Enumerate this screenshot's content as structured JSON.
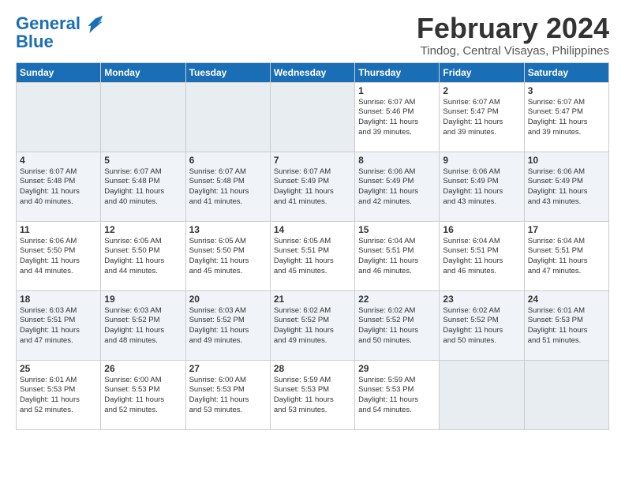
{
  "header": {
    "logo_text1": "General",
    "logo_text2": "Blue",
    "month": "February 2024",
    "location": "Tindog, Central Visayas, Philippines"
  },
  "days_of_week": [
    "Sunday",
    "Monday",
    "Tuesday",
    "Wednesday",
    "Thursday",
    "Friday",
    "Saturday"
  ],
  "weeks": [
    [
      {
        "day": "",
        "info": ""
      },
      {
        "day": "",
        "info": ""
      },
      {
        "day": "",
        "info": ""
      },
      {
        "day": "",
        "info": ""
      },
      {
        "day": "1",
        "info": "Sunrise: 6:07 AM\nSunset: 5:46 PM\nDaylight: 11 hours\nand 39 minutes."
      },
      {
        "day": "2",
        "info": "Sunrise: 6:07 AM\nSunset: 5:47 PM\nDaylight: 11 hours\nand 39 minutes."
      },
      {
        "day": "3",
        "info": "Sunrise: 6:07 AM\nSunset: 5:47 PM\nDaylight: 11 hours\nand 39 minutes."
      }
    ],
    [
      {
        "day": "4",
        "info": "Sunrise: 6:07 AM\nSunset: 5:48 PM\nDaylight: 11 hours\nand 40 minutes."
      },
      {
        "day": "5",
        "info": "Sunrise: 6:07 AM\nSunset: 5:48 PM\nDaylight: 11 hours\nand 40 minutes."
      },
      {
        "day": "6",
        "info": "Sunrise: 6:07 AM\nSunset: 5:48 PM\nDaylight: 11 hours\nand 41 minutes."
      },
      {
        "day": "7",
        "info": "Sunrise: 6:07 AM\nSunset: 5:49 PM\nDaylight: 11 hours\nand 41 minutes."
      },
      {
        "day": "8",
        "info": "Sunrise: 6:06 AM\nSunset: 5:49 PM\nDaylight: 11 hours\nand 42 minutes."
      },
      {
        "day": "9",
        "info": "Sunrise: 6:06 AM\nSunset: 5:49 PM\nDaylight: 11 hours\nand 43 minutes."
      },
      {
        "day": "10",
        "info": "Sunrise: 6:06 AM\nSunset: 5:49 PM\nDaylight: 11 hours\nand 43 minutes."
      }
    ],
    [
      {
        "day": "11",
        "info": "Sunrise: 6:06 AM\nSunset: 5:50 PM\nDaylight: 11 hours\nand 44 minutes."
      },
      {
        "day": "12",
        "info": "Sunrise: 6:05 AM\nSunset: 5:50 PM\nDaylight: 11 hours\nand 44 minutes."
      },
      {
        "day": "13",
        "info": "Sunrise: 6:05 AM\nSunset: 5:50 PM\nDaylight: 11 hours\nand 45 minutes."
      },
      {
        "day": "14",
        "info": "Sunrise: 6:05 AM\nSunset: 5:51 PM\nDaylight: 11 hours\nand 45 minutes."
      },
      {
        "day": "15",
        "info": "Sunrise: 6:04 AM\nSunset: 5:51 PM\nDaylight: 11 hours\nand 46 minutes."
      },
      {
        "day": "16",
        "info": "Sunrise: 6:04 AM\nSunset: 5:51 PM\nDaylight: 11 hours\nand 46 minutes."
      },
      {
        "day": "17",
        "info": "Sunrise: 6:04 AM\nSunset: 5:51 PM\nDaylight: 11 hours\nand 47 minutes."
      }
    ],
    [
      {
        "day": "18",
        "info": "Sunrise: 6:03 AM\nSunset: 5:51 PM\nDaylight: 11 hours\nand 47 minutes."
      },
      {
        "day": "19",
        "info": "Sunrise: 6:03 AM\nSunset: 5:52 PM\nDaylight: 11 hours\nand 48 minutes."
      },
      {
        "day": "20",
        "info": "Sunrise: 6:03 AM\nSunset: 5:52 PM\nDaylight: 11 hours\nand 49 minutes."
      },
      {
        "day": "21",
        "info": "Sunrise: 6:02 AM\nSunset: 5:52 PM\nDaylight: 11 hours\nand 49 minutes."
      },
      {
        "day": "22",
        "info": "Sunrise: 6:02 AM\nSunset: 5:52 PM\nDaylight: 11 hours\nand 50 minutes."
      },
      {
        "day": "23",
        "info": "Sunrise: 6:02 AM\nSunset: 5:52 PM\nDaylight: 11 hours\nand 50 minutes."
      },
      {
        "day": "24",
        "info": "Sunrise: 6:01 AM\nSunset: 5:53 PM\nDaylight: 11 hours\nand 51 minutes."
      }
    ],
    [
      {
        "day": "25",
        "info": "Sunrise: 6:01 AM\nSunset: 5:53 PM\nDaylight: 11 hours\nand 52 minutes."
      },
      {
        "day": "26",
        "info": "Sunrise: 6:00 AM\nSunset: 5:53 PM\nDaylight: 11 hours\nand 52 minutes."
      },
      {
        "day": "27",
        "info": "Sunrise: 6:00 AM\nSunset: 5:53 PM\nDaylight: 11 hours\nand 53 minutes."
      },
      {
        "day": "28",
        "info": "Sunrise: 5:59 AM\nSunset: 5:53 PM\nDaylight: 11 hours\nand 53 minutes."
      },
      {
        "day": "29",
        "info": "Sunrise: 5:59 AM\nSunset: 5:53 PM\nDaylight: 11 hours\nand 54 minutes."
      },
      {
        "day": "",
        "info": ""
      },
      {
        "day": "",
        "info": ""
      }
    ]
  ]
}
